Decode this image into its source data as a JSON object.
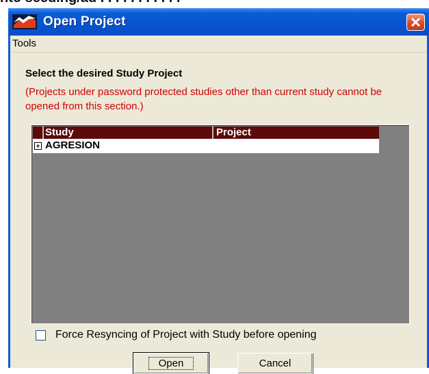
{
  "window": {
    "title": "Open Project"
  },
  "menu": {
    "tools": "Tools"
  },
  "dialog": {
    "heading": "Select the desired Study Project",
    "warning": "(Projects under password protected studies other than current study cannot be opened from this section.)"
  },
  "table": {
    "columns": [
      "Study",
      "Project"
    ],
    "rows": [
      {
        "expander": "+",
        "study": "AGRESION",
        "project": ""
      }
    ]
  },
  "force_resync": {
    "label": "Force Resyncing of Project with Study before opening",
    "checked": false
  },
  "buttons": {
    "open": "Open",
    "cancel": "Cancel"
  },
  "background": {
    "text": "nto seeding/ad . . . . . . . . . . ."
  },
  "colors": {
    "titlebar": "#0a5ad6",
    "close_button": "#dc4b25",
    "warning_text": "#d00000",
    "table_header": "#5c0a0a",
    "list_background": "#808080",
    "dialog_face": "#ece9d8"
  },
  "icons": {
    "app": "app-logo-icon",
    "close": "close-icon",
    "expand": "plus-expand-icon"
  }
}
